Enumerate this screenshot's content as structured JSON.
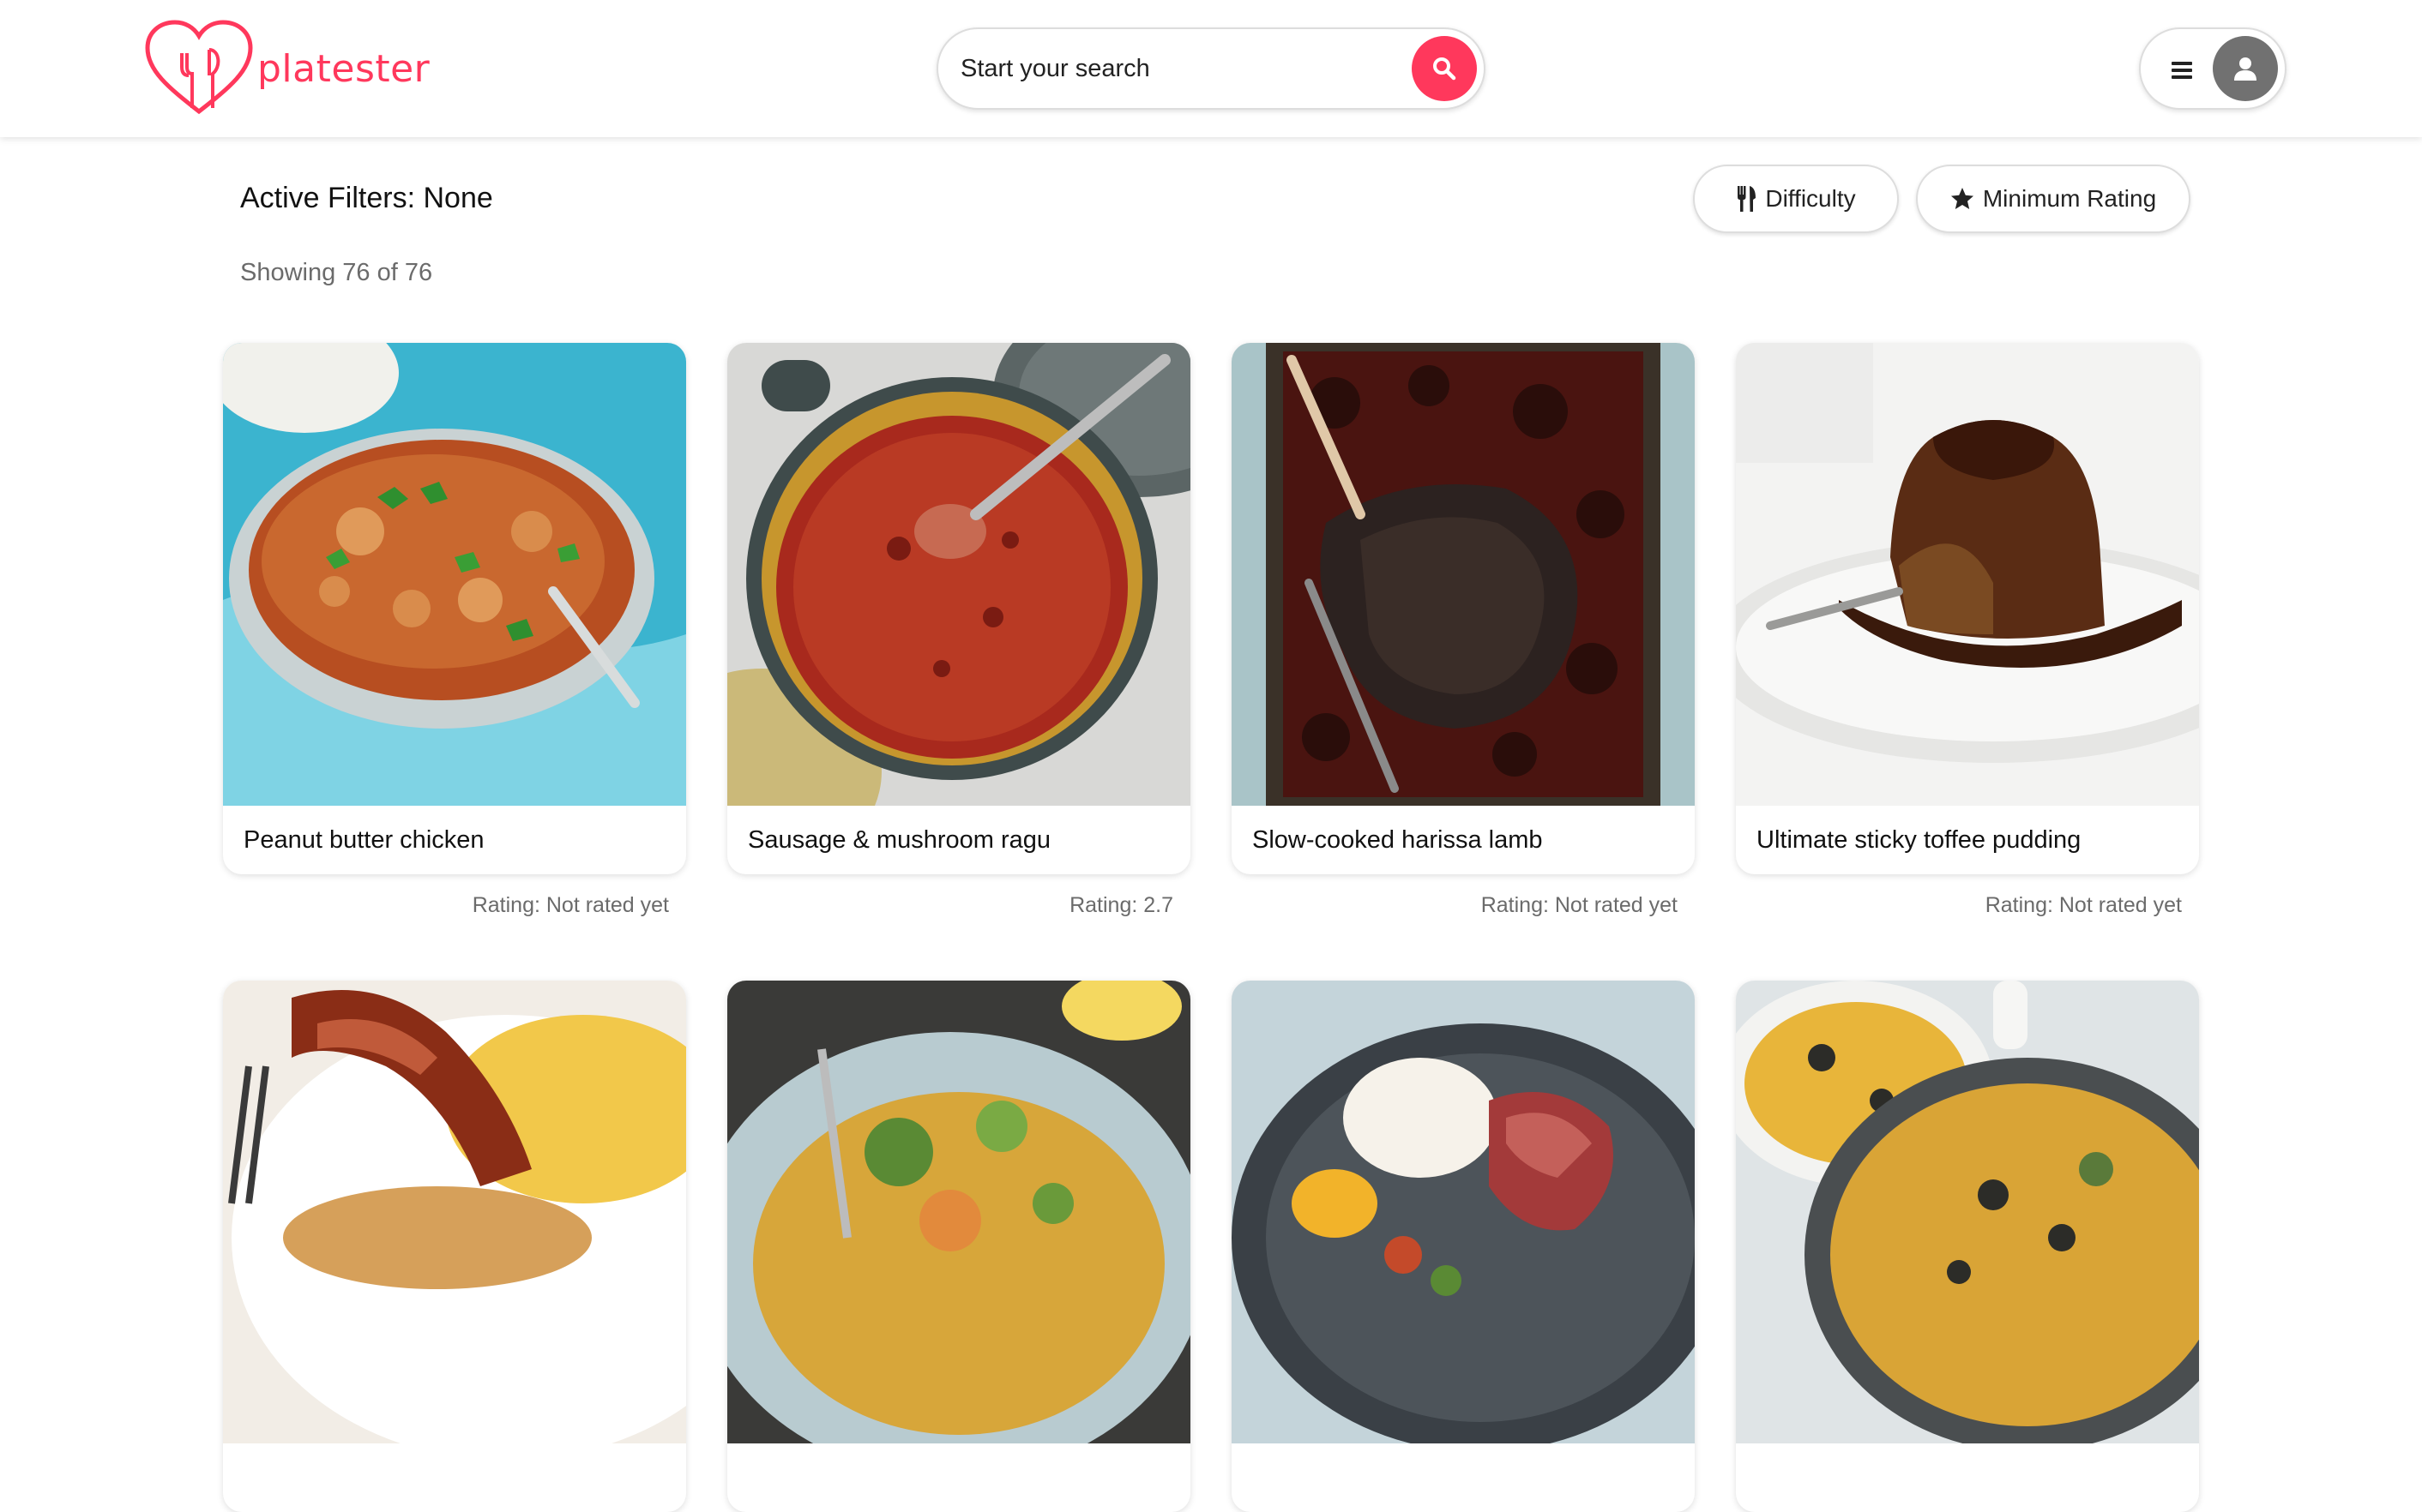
{
  "brand": {
    "name": "platester",
    "accent": "#ff385c"
  },
  "header": {
    "search_placeholder": "Start your search",
    "search_icon": "search-icon",
    "menu_icon": "hamburger-icon",
    "user_icon": "user-icon"
  },
  "filters": {
    "active_label": "Active Filters: None",
    "difficulty_label": "Difficulty",
    "difficulty_icon": "utensils-icon",
    "rating_label": "Minimum Rating",
    "rating_icon": "star-icon",
    "showing": "Showing 76 of 76"
  },
  "recipes": [
    {
      "title": "Peanut butter chicken",
      "rating": "Rating: Not rated yet"
    },
    {
      "title": "Sausage & mushroom ragu",
      "rating": "Rating: 2.7"
    },
    {
      "title": "Slow-cooked harissa lamb",
      "rating": "Rating: Not rated yet"
    },
    {
      "title": "Ultimate sticky toffee pudding",
      "rating": "Rating: Not rated yet"
    },
    {
      "title": "",
      "rating": ""
    },
    {
      "title": "",
      "rating": ""
    },
    {
      "title": "",
      "rating": ""
    },
    {
      "title": "",
      "rating": ""
    }
  ]
}
